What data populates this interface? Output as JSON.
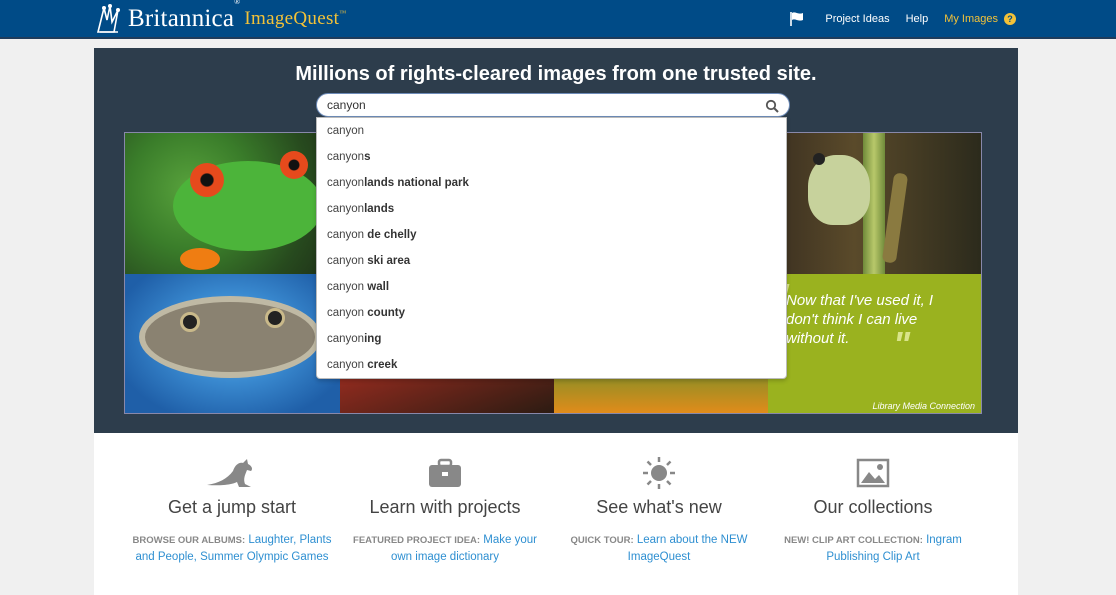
{
  "header": {
    "brand": "Britannica",
    "brand_mark": "®",
    "product": "ImageQuest",
    "product_mark": "™",
    "nav": {
      "flag_icon": "flag-icon",
      "project_ideas": "Project Ideas",
      "help": "Help",
      "my_images": "My Images",
      "help_badge": "?"
    },
    "colors": {
      "bar": "#004b87",
      "accent": "#f3c238"
    }
  },
  "hero": {
    "title": "Millions of rights-cleared images from one trusted site.",
    "quote": "Now that I've used it, I don't think I can live without it.",
    "quote_credit": "Library Media Connection"
  },
  "search": {
    "value": "canyon",
    "icon": "search-icon",
    "suggestions": [
      {
        "prefix": "canyon",
        "suffix": ""
      },
      {
        "prefix": "canyon",
        "suffix": "s"
      },
      {
        "prefix": "canyon",
        "suffix": "lands national park"
      },
      {
        "prefix": "canyon",
        "suffix": "lands"
      },
      {
        "prefix": "canyon",
        "suffix": " de chelly"
      },
      {
        "prefix": "canyon",
        "suffix": " ski area"
      },
      {
        "prefix": "canyon",
        "suffix": " wall"
      },
      {
        "prefix": "canyon",
        "suffix": " county"
      },
      {
        "prefix": "canyon",
        "suffix": "ing"
      },
      {
        "prefix": "canyon",
        "suffix": " creek"
      }
    ]
  },
  "features": [
    {
      "icon": "kangaroo-icon",
      "title": "Get a jump start",
      "label": "BROWSE OUR ALBUMS:",
      "link": "Laughter, Plants and People, Summer Olympic Games"
    },
    {
      "icon": "briefcase-icon",
      "title": "Learn with projects",
      "label": "FEATURED PROJECT IDEA:",
      "link": "Make your own image dictionary"
    },
    {
      "icon": "sun-icon",
      "title": "See what's new",
      "label": "QUICK TOUR:",
      "link": "Learn about the NEW ImageQuest"
    },
    {
      "icon": "image-icon",
      "title": "Our collections",
      "label": "NEW! CLIP ART COLLECTION:",
      "link": "Ingram Publishing Clip Art"
    }
  ]
}
